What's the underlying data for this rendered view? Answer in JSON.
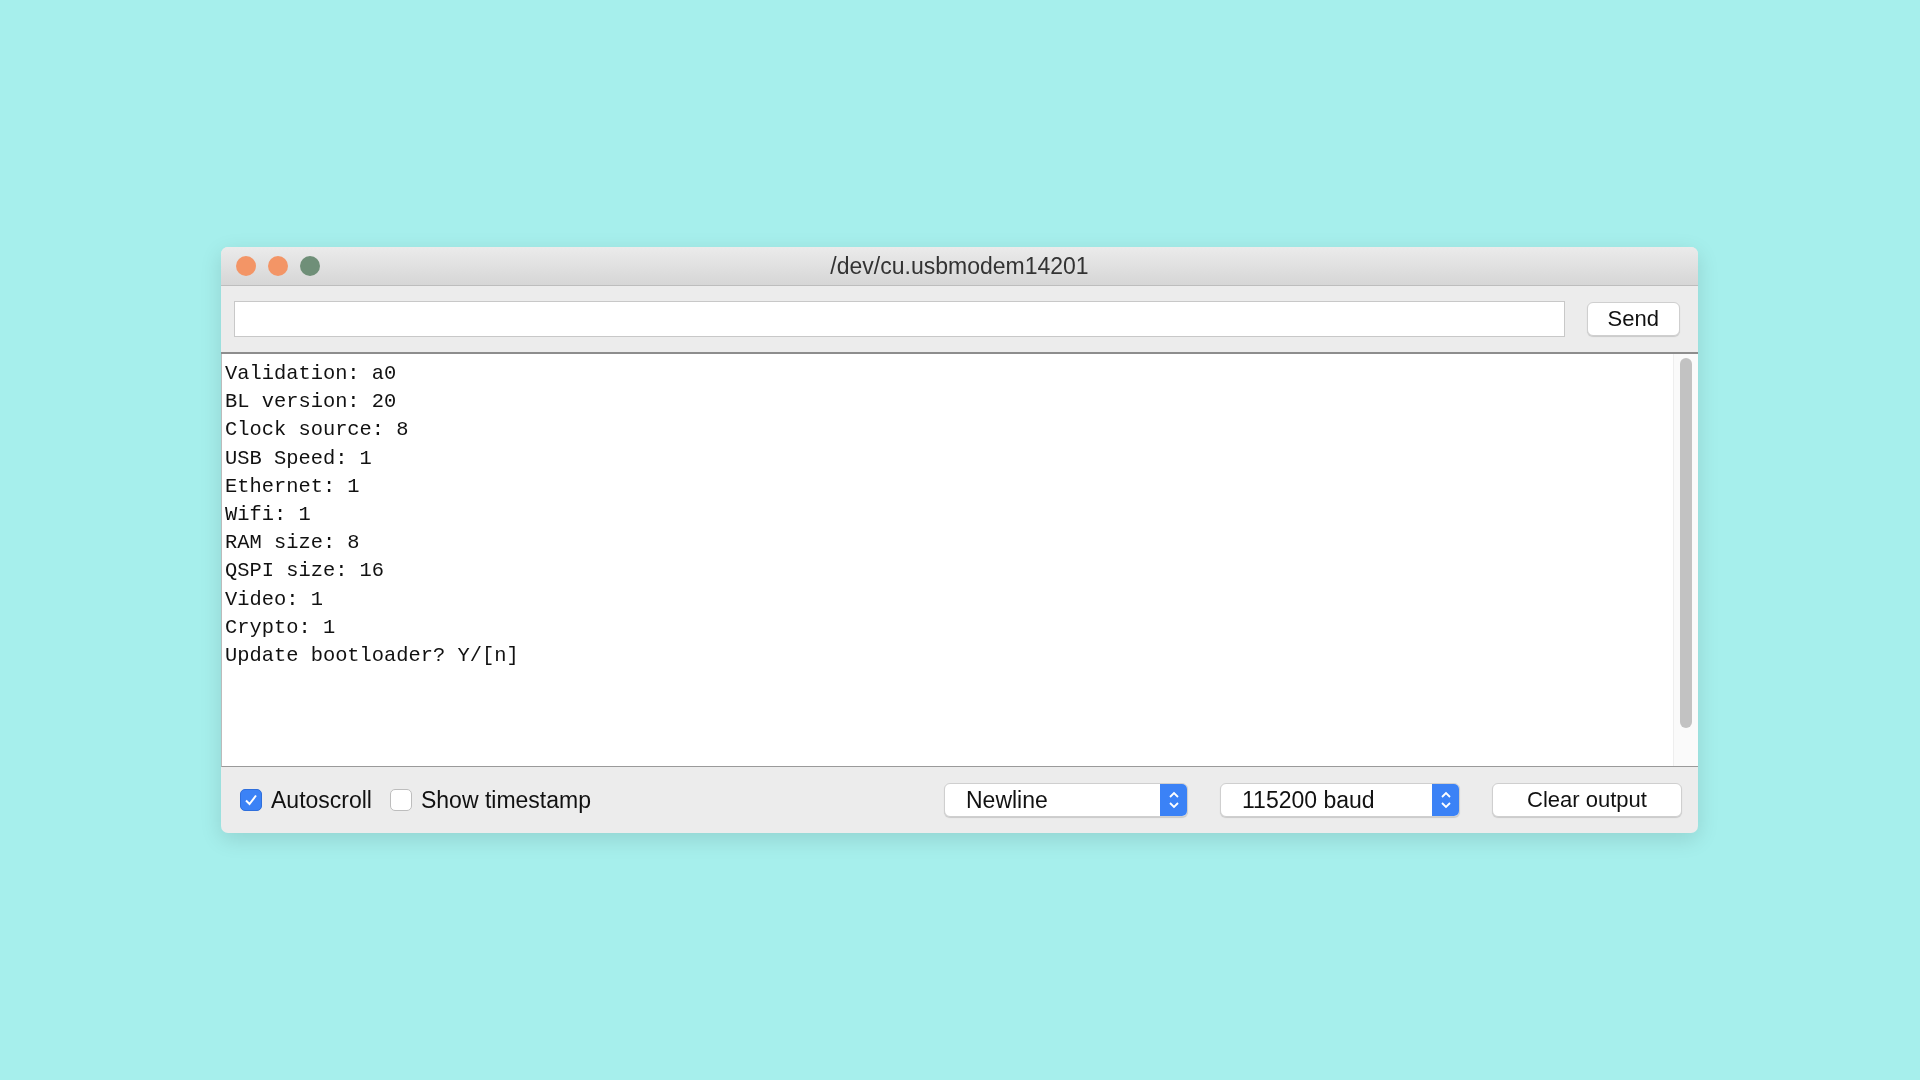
{
  "window": {
    "title": "/dev/cu.usbmodem14201"
  },
  "send_button": {
    "label": "Send"
  },
  "output": {
    "lines": [
      "Validation: a0",
      "BL version: 20",
      "Clock source: 8",
      "USB Speed: 1",
      "Ethernet: 1",
      "Wifi: 1",
      "RAM size: 8",
      "QSPI size: 16",
      "Video: 1",
      "Crypto: 1",
      "Update bootloader? Y/[n]"
    ]
  },
  "options": [
    {
      "label": "Autoscroll",
      "checked": true
    },
    {
      "label": "Show timestamp",
      "checked": false
    }
  ],
  "line_ending": {
    "value": "Newline"
  },
  "baud_rate": {
    "value": "115200 baud"
  },
  "clear_button": {
    "label": "Clear output"
  }
}
